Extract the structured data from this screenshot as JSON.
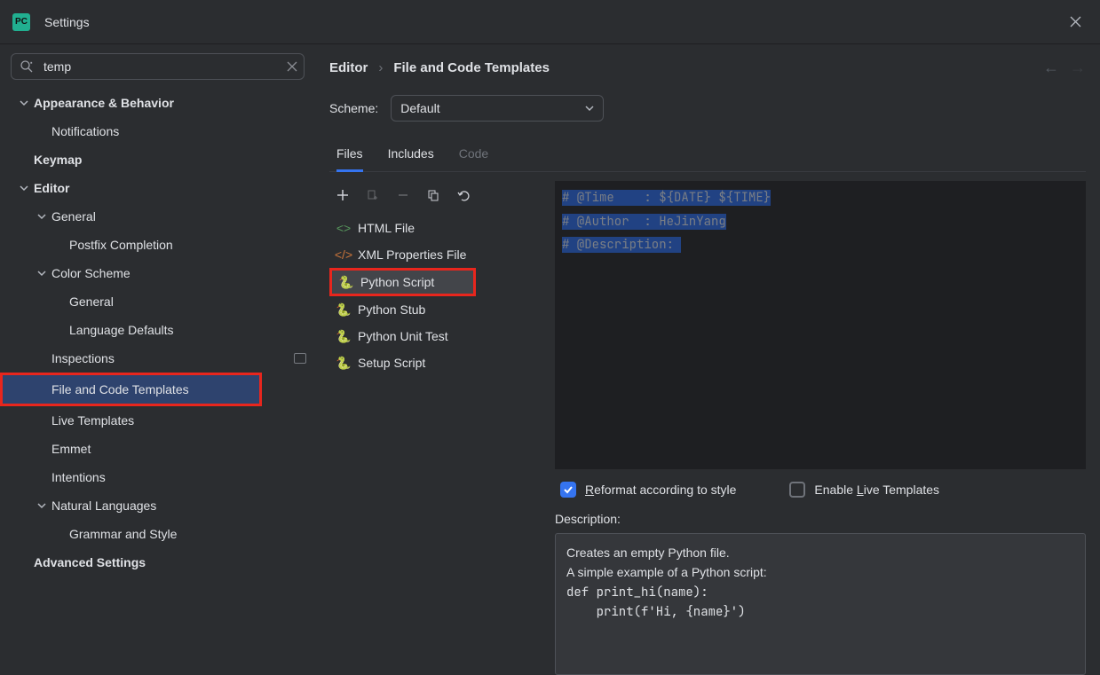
{
  "window": {
    "title": "Settings"
  },
  "search": {
    "value": "temp"
  },
  "sidebar": {
    "appearance": "Appearance & Behavior",
    "notifications": "Notifications",
    "keymap": "Keymap",
    "editor": "Editor",
    "general": "General",
    "postfix": "Postfix Completion",
    "colorscheme": "Color Scheme",
    "cs_general": "General",
    "cs_langdef": "Language Defaults",
    "inspections": "Inspections",
    "file_templates": "File and Code Templates",
    "live_templates": "Live Templates",
    "emmet": "Emmet",
    "intentions": "Intentions",
    "nat_lang": "Natural Languages",
    "grammar": "Grammar and Style",
    "advanced": "Advanced Settings"
  },
  "breadcrumb": {
    "a": "Editor",
    "b": "File and Code Templates"
  },
  "scheme": {
    "label": "Scheme:",
    "value": "Default"
  },
  "tabs": {
    "files": "Files",
    "includes": "Includes",
    "code": "Code"
  },
  "templates": {
    "html": "HTML File",
    "xml": "XML Properties File",
    "python_script": "Python Script",
    "python_stub": "Python Stub",
    "python_unit": "Python Unit Test",
    "setup": "Setup Script"
  },
  "code": {
    "l1a": "# @Time    : ",
    "l1b": "${DATE} ${TIME}",
    "l2": "# @Author  : HeJinYang",
    "l3": "# @Description: "
  },
  "opts": {
    "reformat_pre": "R",
    "reformat_rest": "eformat according to style",
    "live_pre": "Enable ",
    "live_u": "L",
    "live_rest": "ive Templates"
  },
  "desc": {
    "label": "Description:",
    "l1": "Creates an empty Python file.",
    "l2": "A simple example of a Python script:",
    "l3": "def print_hi(name):",
    "l4": "    print(f'Hi, {name}')"
  }
}
